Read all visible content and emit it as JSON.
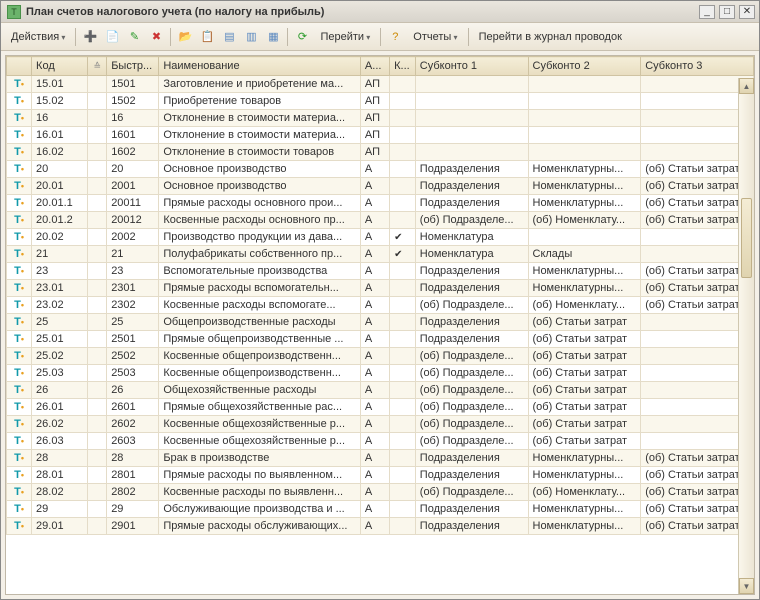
{
  "window": {
    "title": "План счетов налогового учета (по налогу на прибыль)"
  },
  "toolbar": {
    "actions": "Действия",
    "goto": "Перейти",
    "reports": "Отчеты",
    "journal": "Перейти в журнал проводок"
  },
  "columns": {
    "icon": "",
    "code": "Код",
    "fast": "Быстр...",
    "name": "Наименование",
    "a": "А...",
    "k": "К...",
    "s1": "Субконто 1",
    "s2": "Субконто 2",
    "s3": "Субконто 3"
  },
  "rows": [
    {
      "code": "15.01",
      "fast": "1501",
      "name": "Заготовление и приобретение ма...",
      "a": "АП",
      "k": "",
      "s1": "",
      "s2": "",
      "s3": ""
    },
    {
      "code": "15.02",
      "fast": "1502",
      "name": "Приобретение товаров",
      "a": "АП",
      "k": "",
      "s1": "",
      "s2": "",
      "s3": ""
    },
    {
      "code": "16",
      "fast": "16",
      "name": "Отклонение в стоимости материа...",
      "a": "АП",
      "k": "",
      "s1": "",
      "s2": "",
      "s3": ""
    },
    {
      "code": "16.01",
      "fast": "1601",
      "name": "Отклонение в стоимости материа...",
      "a": "АП",
      "k": "",
      "s1": "",
      "s2": "",
      "s3": ""
    },
    {
      "code": "16.02",
      "fast": "1602",
      "name": "Отклонение в стоимости товаров",
      "a": "АП",
      "k": "",
      "s1": "",
      "s2": "",
      "s3": ""
    },
    {
      "code": "20",
      "fast": "20",
      "name": "Основное производство",
      "a": "А",
      "k": "",
      "s1": "Подразделения",
      "s2": "Номенклатурны...",
      "s3": "(об) Статьи затрат"
    },
    {
      "code": "20.01",
      "fast": "2001",
      "name": "Основное производство",
      "a": "А",
      "k": "",
      "s1": "Подразделения",
      "s2": "Номенклатурны...",
      "s3": "(об) Статьи затрат"
    },
    {
      "code": "20.01.1",
      "fast": "20011",
      "name": "Прямые расходы основного прои...",
      "a": "А",
      "k": "",
      "s1": "Подразделения",
      "s2": "Номенклатурны...",
      "s3": "(об) Статьи затрат"
    },
    {
      "code": "20.01.2",
      "fast": "20012",
      "name": "Косвенные расходы основного пр...",
      "a": "А",
      "k": "",
      "s1": "(об) Подразделе...",
      "s2": "(об) Номенклату...",
      "s3": "(об) Статьи затрат"
    },
    {
      "code": "20.02",
      "fast": "2002",
      "name": "Производство продукции из дава...",
      "a": "А",
      "k": "✔",
      "s1": "Номенклатура",
      "s2": "",
      "s3": ""
    },
    {
      "code": "21",
      "fast": "21",
      "name": "Полуфабрикаты собственного пр...",
      "a": "А",
      "k": "✔",
      "s1": "Номенклатура",
      "s2": "Склады",
      "s3": ""
    },
    {
      "code": "23",
      "fast": "23",
      "name": "Вспомогательные производства",
      "a": "А",
      "k": "",
      "s1": "Подразделения",
      "s2": "Номенклатурны...",
      "s3": "(об) Статьи затрат"
    },
    {
      "code": "23.01",
      "fast": "2301",
      "name": "Прямые расходы вспомогательн...",
      "a": "А",
      "k": "",
      "s1": "Подразделения",
      "s2": "Номенклатурны...",
      "s3": "(об) Статьи затрат"
    },
    {
      "code": "23.02",
      "fast": "2302",
      "name": "Косвенные расходы вспомогате...",
      "a": "А",
      "k": "",
      "s1": "(об) Подразделе...",
      "s2": "(об) Номенклату...",
      "s3": "(об) Статьи затрат"
    },
    {
      "code": "25",
      "fast": "25",
      "name": "Общепроизводственные расходы",
      "a": "А",
      "k": "",
      "s1": "Подразделения",
      "s2": "(об) Статьи затрат",
      "s3": ""
    },
    {
      "code": "25.01",
      "fast": "2501",
      "name": "Прямые общепроизводственные ...",
      "a": "А",
      "k": "",
      "s1": "Подразделения",
      "s2": "(об) Статьи затрат",
      "s3": ""
    },
    {
      "code": "25.02",
      "fast": "2502",
      "name": "Косвенные общепроизводственн...",
      "a": "А",
      "k": "",
      "s1": "(об) Подразделе...",
      "s2": "(об) Статьи затрат",
      "s3": ""
    },
    {
      "code": "25.03",
      "fast": "2503",
      "name": "Косвенные общепроизводственн...",
      "a": "А",
      "k": "",
      "s1": "(об) Подразделе...",
      "s2": "(об) Статьи затрат",
      "s3": ""
    },
    {
      "code": "26",
      "fast": "26",
      "name": "Общехозяйственные расходы",
      "a": "А",
      "k": "",
      "s1": "(об) Подразделе...",
      "s2": "(об) Статьи затрат",
      "s3": ""
    },
    {
      "code": "26.01",
      "fast": "2601",
      "name": "Прямые общехозяйственные рас...",
      "a": "А",
      "k": "",
      "s1": "(об) Подразделе...",
      "s2": "(об) Статьи затрат",
      "s3": ""
    },
    {
      "code": "26.02",
      "fast": "2602",
      "name": "Косвенные общехозяйственные р...",
      "a": "А",
      "k": "",
      "s1": "(об) Подразделе...",
      "s2": "(об) Статьи затрат",
      "s3": ""
    },
    {
      "code": "26.03",
      "fast": "2603",
      "name": "Косвенные общехозяйственные р...",
      "a": "А",
      "k": "",
      "s1": "(об) Подразделе...",
      "s2": "(об) Статьи затрат",
      "s3": ""
    },
    {
      "code": "28",
      "fast": "28",
      "name": "Брак в производстве",
      "a": "А",
      "k": "",
      "s1": "Подразделения",
      "s2": "Номенклатурны...",
      "s3": "(об) Статьи затрат"
    },
    {
      "code": "28.01",
      "fast": "2801",
      "name": "Прямые расходы по выявленном...",
      "a": "А",
      "k": "",
      "s1": "Подразделения",
      "s2": "Номенклатурны...",
      "s3": "(об) Статьи затрат"
    },
    {
      "code": "28.02",
      "fast": "2802",
      "name": "Косвенные расходы по выявленн...",
      "a": "А",
      "k": "",
      "s1": "(об) Подразделе...",
      "s2": "(об) Номенклату...",
      "s3": "(об) Статьи затрат"
    },
    {
      "code": "29",
      "fast": "29",
      "name": "Обслуживающие производства и ...",
      "a": "А",
      "k": "",
      "s1": "Подразделения",
      "s2": "Номенклатурны...",
      "s3": "(об) Статьи затрат"
    },
    {
      "code": "29.01",
      "fast": "2901",
      "name": "Прямые расходы обслуживающих...",
      "a": "А",
      "k": "",
      "s1": "Подразделения",
      "s2": "Номенклатурны...",
      "s3": "(об) Статьи затрат"
    }
  ]
}
